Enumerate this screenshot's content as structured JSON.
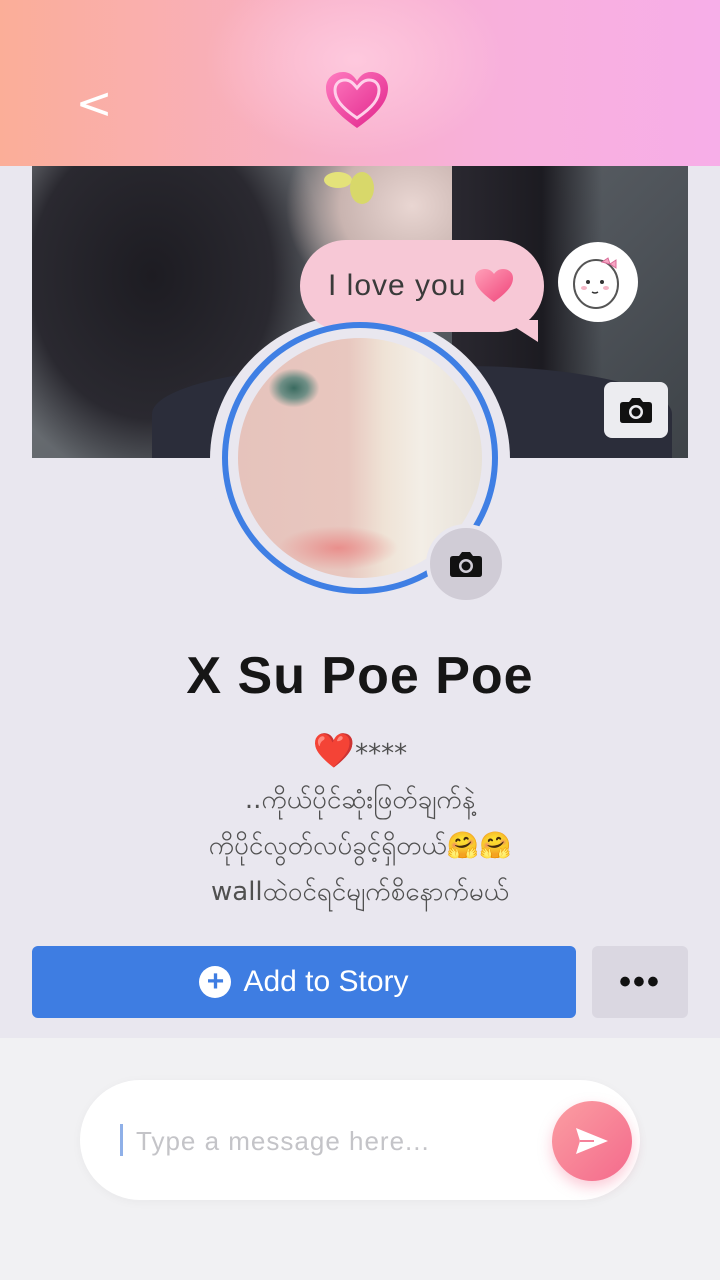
{
  "header": {
    "back_icon": "chevron-left-icon",
    "center_icon": "heart-icon",
    "gradient_colors": [
      "#fbae98",
      "#f7aee8"
    ]
  },
  "cover": {
    "bubble_text": "I love you",
    "bubble_icon": "heart-icon",
    "sticker_icon": "sticker-character-icon",
    "camera_icon": "camera-icon"
  },
  "avatar": {
    "ring_color": "#3f7fe4",
    "camera_icon": "camera-icon"
  },
  "profile": {
    "name": "X Su Poe Poe",
    "bio_lines": [
      "****",
      "..ကိုယ်ပိုင်ဆုံးဖြတ်ချက်နဲ့",
      "ကိုပိုင်လွတ်လပ်ခွင့်ရှိတယ်🤗🤗",
      "wallထဲဝင်ရင်မျက်စိနောက်မယ်"
    ],
    "bio_heart": "❤️"
  },
  "actions": {
    "add_story_label": "Add to Story",
    "add_story_icon": "plus-circle-icon",
    "more_label": "•••",
    "accent_color": "#3e7de2"
  },
  "message": {
    "placeholder": "Type a message here...",
    "send_icon": "send-icon"
  }
}
